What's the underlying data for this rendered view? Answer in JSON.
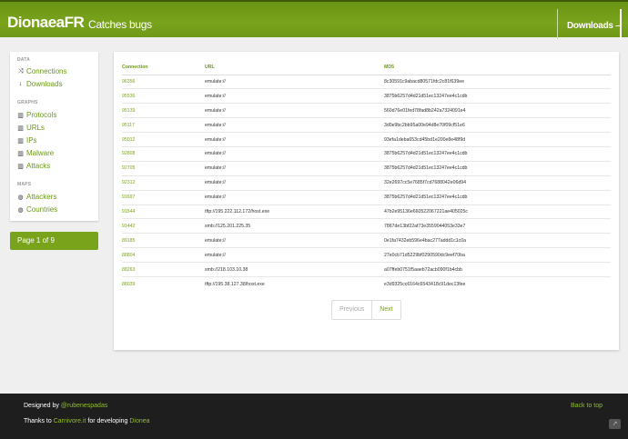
{
  "header": {
    "brand": "DionaeaFR",
    "tagline": "Catches bugs",
    "nav_active": "Downloads –"
  },
  "sidebar": {
    "sections": [
      {
        "title": "DATA",
        "items": [
          {
            "icon": "shuffle-icon",
            "label": "Connections"
          },
          {
            "icon": "download-arrow-icon",
            "label": "Downloads"
          }
        ]
      },
      {
        "title": "GRAPHS",
        "items": [
          {
            "icon": "bar-chart-icon",
            "label": "Protocols"
          },
          {
            "icon": "bar-chart-icon",
            "label": "URLs"
          },
          {
            "icon": "bar-chart-icon",
            "label": "IPs"
          },
          {
            "icon": "bar-chart-icon",
            "label": "Malware"
          },
          {
            "icon": "bar-chart-icon",
            "label": "Attacks"
          }
        ]
      },
      {
        "title": "MAPS",
        "items": [
          {
            "icon": "globe-icon",
            "label": "Attackers"
          },
          {
            "icon": "globe-icon",
            "label": "Countries"
          }
        ]
      }
    ],
    "page_indicator": "Page 1 of 9"
  },
  "table": {
    "columns": [
      "Connection",
      "URL",
      "MD5"
    ],
    "rows": [
      [
        "96356",
        "emulate://",
        "8c30591c9abacd80571fdc2c81f639ee"
      ],
      [
        "95536",
        "emulate://",
        "3875b6257d4d21d51ec13247ee4c1cdb"
      ],
      [
        "95139",
        "emulate://",
        "560d76e01fed78fad8b242a7324091e4"
      ],
      [
        "95117",
        "emulate://",
        "3d0e9bc2bb95a00e94d8e70f09cf51e6"
      ],
      [
        "95012",
        "emulate://",
        "93efa1deba653cd45bd1e200e8e48f9d"
      ],
      [
        "92808",
        "emulate://",
        "3875b6257d4d21d51ec13247ee4c1cdb"
      ],
      [
        "92705",
        "emulate://",
        "3875b6257d4d21d51ec13247ee4c1cdb"
      ],
      [
        "92312",
        "emulate://",
        "32e2697cc5e7685f7cd7688042e06d94"
      ],
      [
        "91697",
        "emulate://",
        "3875b6257d4d21d51ec13247ee4c1cdb"
      ],
      [
        "91544",
        "tftp://195.222.112.172/host.exe",
        "47b2e95136e660522067221ae405025c"
      ],
      [
        "91442",
        "smb://125.201.225.35",
        "7867de13bf22af73e3559044053e33e7"
      ],
      [
        "89185",
        "emulate://",
        "0e1fa7432eb596e4bac277addd1c1c0a"
      ],
      [
        "88804",
        "emulate://",
        "27e0cb71d5229bf0290590dc9eef70ba"
      ],
      [
        "88263",
        "smb://218.103.10.38",
        "a07ffeb0751f5aaeb72acb090f1b4cbb"
      ],
      [
        "88039",
        "tftp://195.38.127.38/host.exe",
        "e3d9325cc6164c6543418c91dec13fee"
      ]
    ]
  },
  "pager": {
    "prev": "Previous",
    "next": "Next"
  },
  "footer": {
    "designed_by": "Designed by ",
    "designer": "@rubenespadas",
    "thanks": "Thanks to ",
    "carnivore": "Carnivore.it",
    "for_dev": " for developing ",
    "dionea": "Dionea",
    "back_to_top": "Back to top",
    "button_icon": "share-icon"
  },
  "colors": {
    "header_green": "#7aa31c",
    "link_green": "#6a9a12",
    "footer_bg": "#1e1e1e"
  }
}
